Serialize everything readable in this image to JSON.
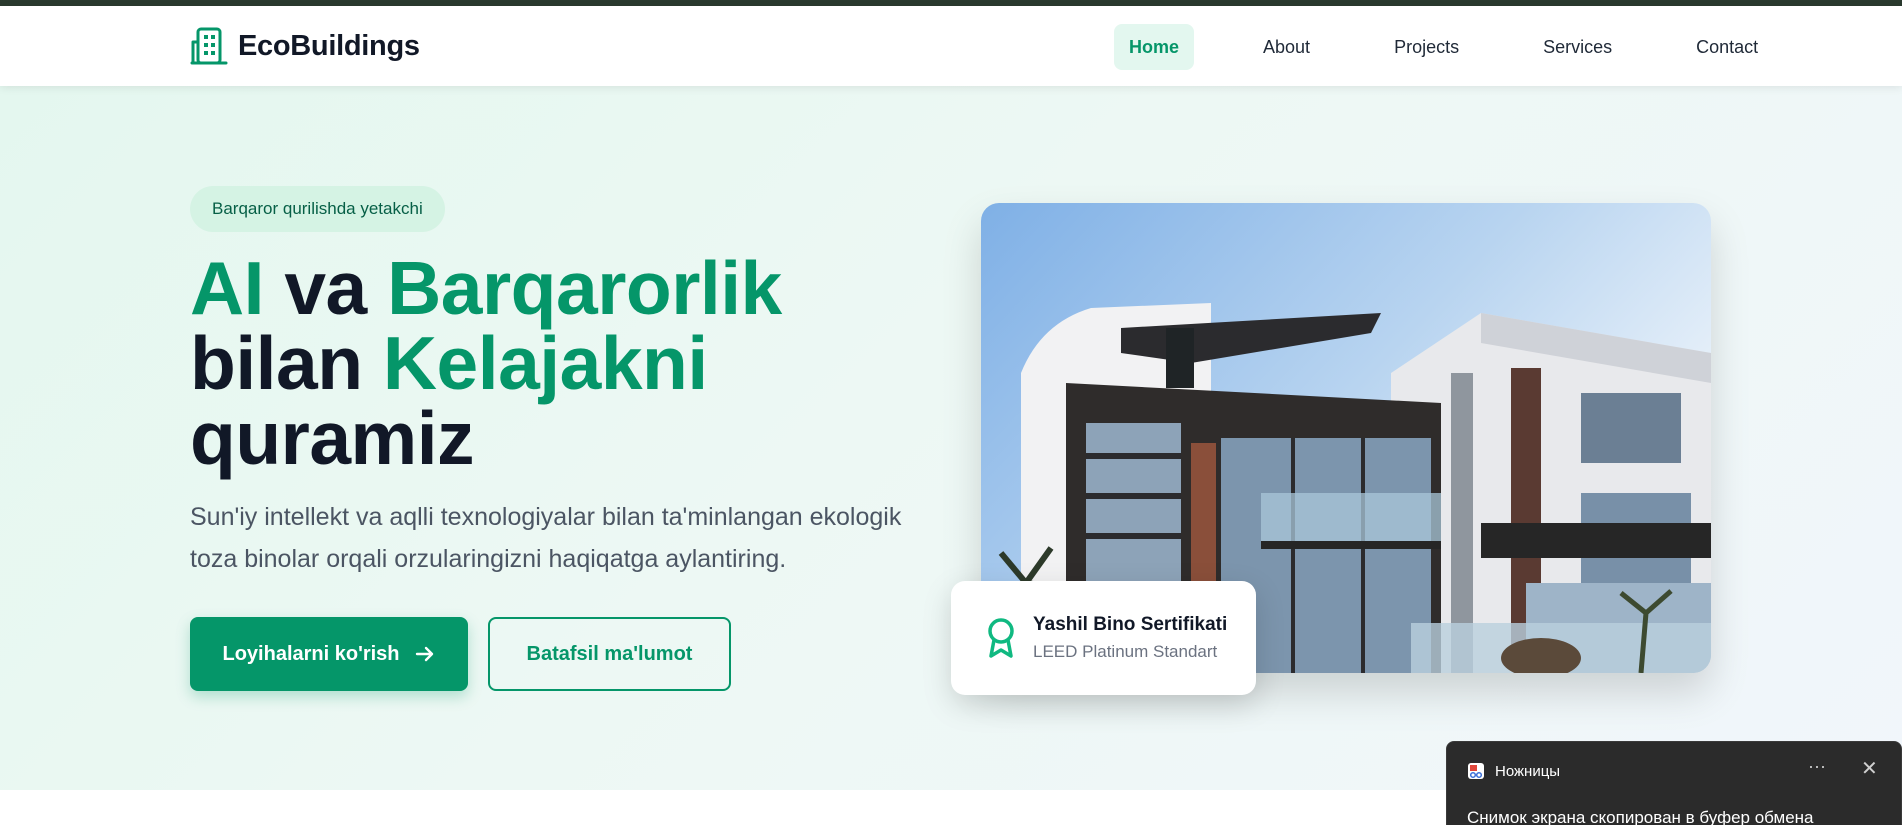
{
  "brand": {
    "name": "EcoBuildings",
    "icon": "building-icon",
    "color": "#059669"
  },
  "nav": {
    "items": [
      {
        "label": "Home",
        "active": true
      },
      {
        "label": "About",
        "active": false
      },
      {
        "label": "Projects",
        "active": false
      },
      {
        "label": "Services",
        "active": false
      },
      {
        "label": "Contact",
        "active": false
      }
    ]
  },
  "hero": {
    "badge": "Barqaror qurilishda yetakchi",
    "headline": {
      "part1": "AI",
      "part2": " va ",
      "part3": "Barqarorlik",
      "part4": "bilan ",
      "part5": "Kelajakni",
      "part6": "quramiz"
    },
    "subtext": "Sun'iy intellekt va aqlli texnologiyalar bilan ta'minlangan ekologik toza binolar orqali orzularingizni haqiqatga aylantiring.",
    "primary_button": "Loyihalarni ko'rish",
    "secondary_button": "Batafsil ma'lumot",
    "certificate": {
      "title": "Yashil Bino Sertifikati",
      "subtitle": "LEED Platinum Standart",
      "icon": "award-ribbon-icon"
    }
  },
  "toast": {
    "app_name": "Ножницы",
    "message": "Снимок экрана скопирован в буфер обмена",
    "more_label": "···",
    "close_label": "✕"
  },
  "colors": {
    "accent": "#059669",
    "dark_text": "#111827",
    "badge_bg": "#d5f3e4",
    "top_line": "#2a3a2e"
  }
}
